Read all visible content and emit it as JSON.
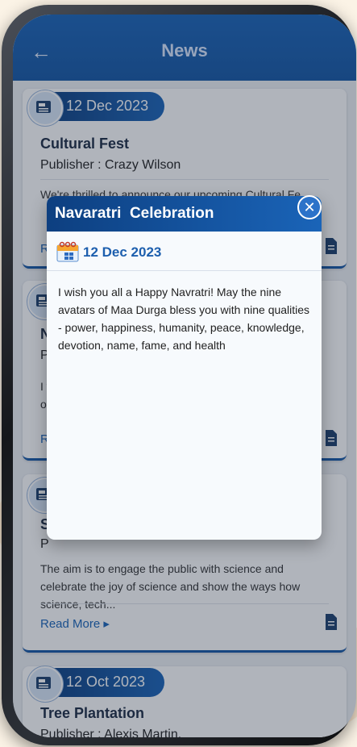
{
  "appbar": {
    "title": "News"
  },
  "cards": [
    {
      "date": "12 Dec 2023",
      "title": "Cultural Fest",
      "publisher": "Publisher : Crazy Wilson",
      "desc": "We're thrilled to announce our upcoming Cultural Fe",
      "read_more": "Re"
    },
    {
      "date": "",
      "title": "N",
      "publisher": "P",
      "desc": "I w\no",
      "read_more": "R"
    },
    {
      "date": "",
      "title": "S",
      "publisher": "P",
      "desc": "The aim is to engage the public with science and celebrate the joy of science and show the ways how science, tech...",
      "read_more": "Read More ▸"
    },
    {
      "date": "12 Oct 2023",
      "title": "Tree Plantation",
      "publisher": "Publisher : Alexis Martin.",
      "desc": "",
      "read_more": ""
    }
  ],
  "modal": {
    "title": "Navaratri  Celebration",
    "date": "12 Dec 2023",
    "body": "I wish you all a Happy Navratri! May the nine avatars of Maa Durga bless you with nine qualities - power, happiness, humanity, peace, knowledge, devotion, name, fame, and health",
    "close": "✕"
  },
  "colors": {
    "primary": "#1557a5",
    "dark": "#0d3f80",
    "background": "#fbf3e6"
  }
}
